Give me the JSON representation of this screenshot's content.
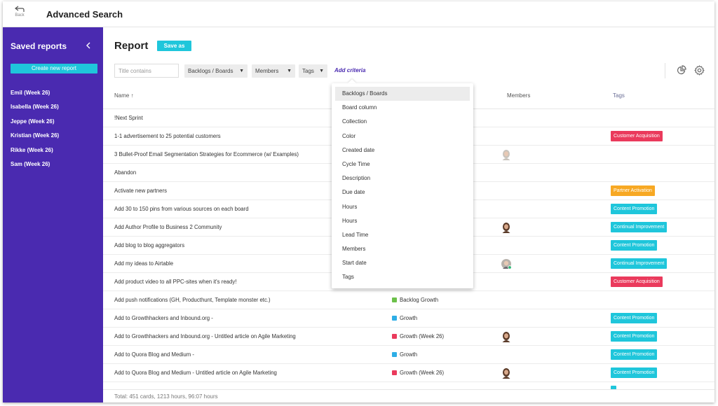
{
  "header": {
    "back_label": "Back",
    "title": "Advanced Search"
  },
  "sidebar": {
    "title": "Saved reports",
    "create_label": "Create new report",
    "items": [
      {
        "label": "Emil (Week 26)"
      },
      {
        "label": "Isabella (Week 26)"
      },
      {
        "label": "Jeppe (Week 26)"
      },
      {
        "label": "Kristian (Week 26)"
      },
      {
        "label": "Rikke (Week 26)"
      },
      {
        "label": "Sam (Week 26)"
      }
    ]
  },
  "report": {
    "title": "Report",
    "save_as_label": "Save as",
    "filters": {
      "title_placeholder": "Title contains",
      "backlogs_label": "Backlogs / Boards",
      "members_label": "Members",
      "tags_label": "Tags",
      "add_criteria_label": "Add criteria"
    },
    "columns": {
      "name": "Name ↑",
      "members": "Members",
      "tags": "Tags"
    },
    "rows": [
      {
        "name": "!Next Sprint",
        "board": "",
        "board_color": "",
        "member": "",
        "tag": "",
        "tag_color": ""
      },
      {
        "name": "1-1 advertisement to 25 potential customers",
        "board": "",
        "board_color": "",
        "member": "",
        "tag": "Customer Acquisition",
        "tag_color": "#ea3a5c"
      },
      {
        "name": "3 Bullet-Proof Email Segmentation Strategies for Ecommerce (w/ Examples)",
        "board": "",
        "board_color": "",
        "member": "woman-light-hair",
        "tag": "",
        "tag_color": ""
      },
      {
        "name": "Abandon",
        "board": "",
        "board_color": "",
        "member": "",
        "tag": "",
        "tag_color": ""
      },
      {
        "name": "Activate new partners",
        "board": "",
        "board_color": "",
        "member": "",
        "tag": "Partner Activation",
        "tag_color": "#f7a823"
      },
      {
        "name": "Add 30 to 150 pins from various sources on each board",
        "board": "",
        "board_color": "",
        "member": "",
        "tag": "Content Promotion",
        "tag_color": "#1fc6db"
      },
      {
        "name": "Add Author Profile to Business 2 Community",
        "board": "",
        "board_color": "",
        "member": "woman-dark-hair",
        "tag": "Continual Improvement",
        "tag_color": "#1fc6db"
      },
      {
        "name": "Add blog to blog aggregators",
        "board": "",
        "board_color": "",
        "member": "",
        "tag": "Content Promotion",
        "tag_color": "#1fc6db"
      },
      {
        "name": "Add my ideas to Airtable",
        "board": "",
        "board_color": "",
        "member": "man-online",
        "tag": "Continual Improvement",
        "tag_color": "#1fc6db"
      },
      {
        "name": "Add product video to all PPC-sites when it's ready!",
        "board": "",
        "board_color": "",
        "member": "",
        "tag": "Customer Acquisition",
        "tag_color": "#ea3a5c"
      },
      {
        "name": "Add push notifications (GH, Producthunt, Template monster etc.)",
        "board": "Backlog Growth",
        "board_color": "#6cc04a",
        "member": "",
        "tag": "",
        "tag_color": ""
      },
      {
        "name": "Add to Growthhackers and Inbound.org -",
        "board": "Growth",
        "board_color": "#2eaee6",
        "member": "",
        "tag": "Content Promotion",
        "tag_color": "#1fc6db"
      },
      {
        "name": "Add to Growthhackers and Inbound.org - Untitled article on Agile Marketing",
        "board": "Growth (Week 26)",
        "board_color": "#ea3a5c",
        "member": "woman-dark-hair",
        "tag": "Content Promotion",
        "tag_color": "#1fc6db"
      },
      {
        "name": "Add to Quora Blog and Medium -",
        "board": "Growth",
        "board_color": "#2eaee6",
        "member": "",
        "tag": "Content Promotion",
        "tag_color": "#1fc6db"
      },
      {
        "name": "Add to Quora Blog and Medium - Untitled article on Agile Marketing",
        "board": "Growth (Week 26)",
        "board_color": "#ea3a5c",
        "member": "woman-dark-hair",
        "tag": "Content Promotion",
        "tag_color": "#1fc6db"
      },
      {
        "name": "",
        "board": "",
        "board_color": "",
        "member": "",
        "tag": "",
        "tag_color": "#1fc6db"
      }
    ],
    "footer": "Total: 451 cards, 1213 hours, 96:07 hours"
  },
  "criteria_menu": {
    "items": [
      {
        "label": "Backlogs / Boards",
        "active": true
      },
      {
        "label": "Board column"
      },
      {
        "label": "Collection"
      },
      {
        "label": "Color"
      },
      {
        "label": "Created date"
      },
      {
        "label": "Cycle Time"
      },
      {
        "label": "Description"
      },
      {
        "label": "Due date"
      },
      {
        "label": "Hours"
      },
      {
        "label": "Hours"
      },
      {
        "label": "Lead Time"
      },
      {
        "label": "Members"
      },
      {
        "label": "Start date"
      },
      {
        "label": "Tags"
      }
    ]
  },
  "icons": [
    "back-arrow-icon",
    "chevron-left-icon",
    "caret-down-icon",
    "chart-icon",
    "gear-icon",
    "avatar-icon"
  ],
  "colors": {
    "sidebar": "#4a2ab0",
    "accent": "#1fc6db",
    "link": "#4a2ab0"
  }
}
